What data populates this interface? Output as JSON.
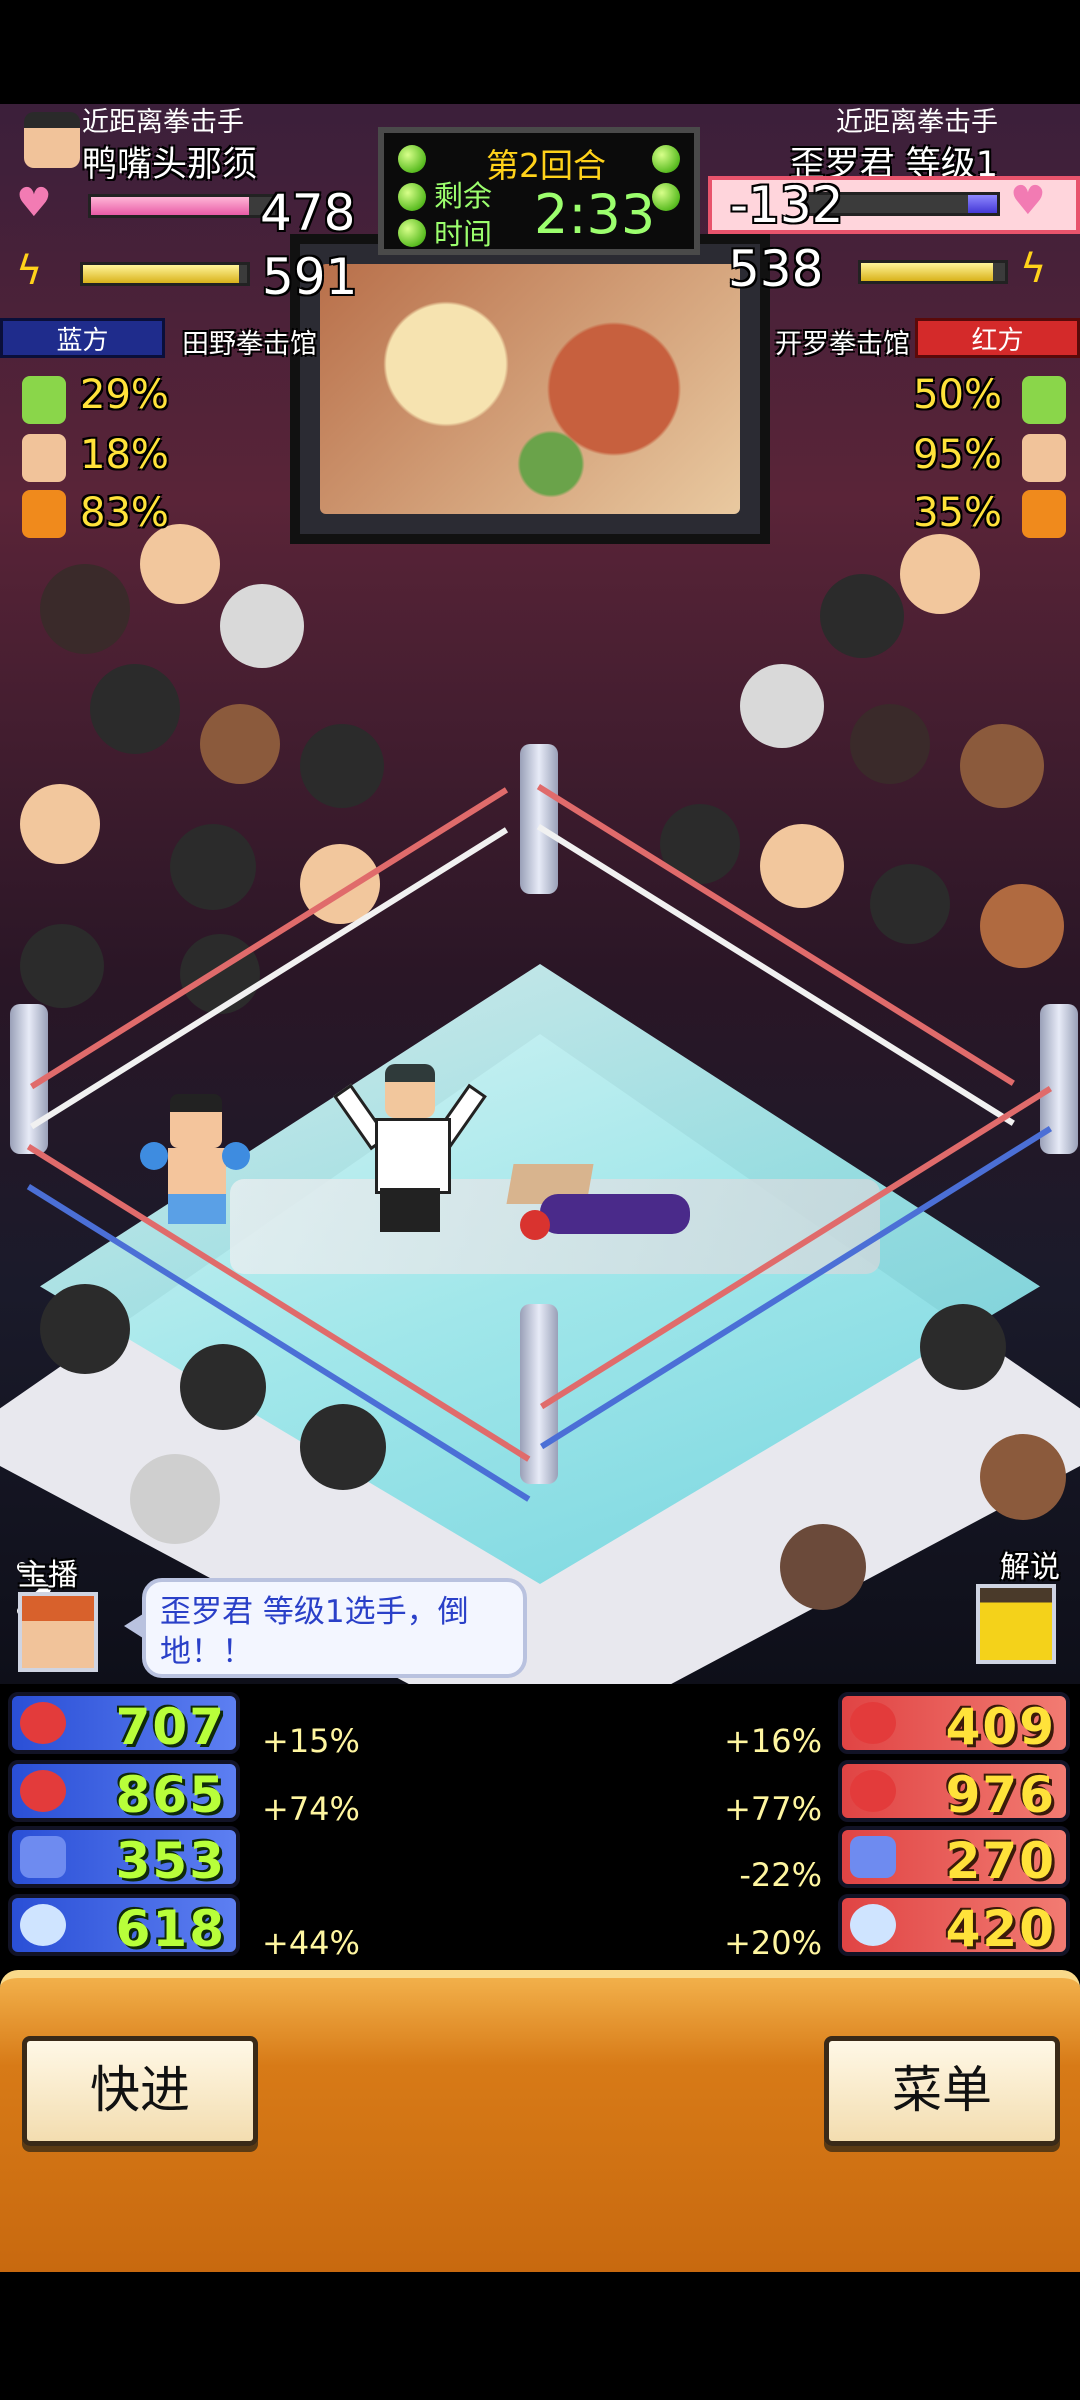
{
  "blue_corner": {
    "title": "近距离拳击手",
    "name": "鸭嘴头那须",
    "hp": "478",
    "hp_ratio": 0.86,
    "stamina": "591",
    "stamina_ratio": 0.95,
    "team": "蓝方",
    "gym": "田野拳击馆",
    "percents": [
      "29%",
      "18%",
      "83%"
    ]
  },
  "red_corner": {
    "title": "近距离拳击手",
    "name": "歪罗君 等级1",
    "hp": "-132",
    "hp_ratio": 0.15,
    "stamina": "538",
    "stamina_ratio": 0.92,
    "team": "红方",
    "gym": "开罗拳击馆",
    "percents": [
      "50%",
      "95%",
      "35%"
    ]
  },
  "scoreboard": {
    "round": "第2回合",
    "remain_line1": "剩余",
    "remain_line2": "时间",
    "timer": "2:33"
  },
  "commentary": {
    "announcer_label": "主播",
    "commentator_label": "解说",
    "message": "歪罗君 等级1选手，倒地！！"
  },
  "stats": {
    "blue": [
      {
        "icon": "glove-icon",
        "value": "707",
        "bonus": "+15%"
      },
      {
        "icon": "muscle-icon",
        "value": "865",
        "bonus": "+74%"
      },
      {
        "icon": "shield-icon",
        "value": "353",
        "bonus": ""
      },
      {
        "icon": "shoe-icon",
        "value": "618",
        "bonus": "+44%"
      }
    ],
    "red": [
      {
        "icon": "glove-icon",
        "value": "409",
        "bonus": "+16%"
      },
      {
        "icon": "muscle-icon",
        "value": "976",
        "bonus": "+77%"
      },
      {
        "icon": "shield-icon",
        "value": "270",
        "bonus": "-22%"
      },
      {
        "icon": "shoe-icon",
        "value": "420",
        "bonus": "+20%"
      }
    ]
  },
  "buttons": {
    "fast_forward": "快进",
    "menu": "菜单"
  },
  "colors": {
    "blue_team": "#1f2c8c",
    "red_team": "#d42a2a",
    "hp_pink": "#e85ca6",
    "timer_green": "#9cff6e"
  }
}
